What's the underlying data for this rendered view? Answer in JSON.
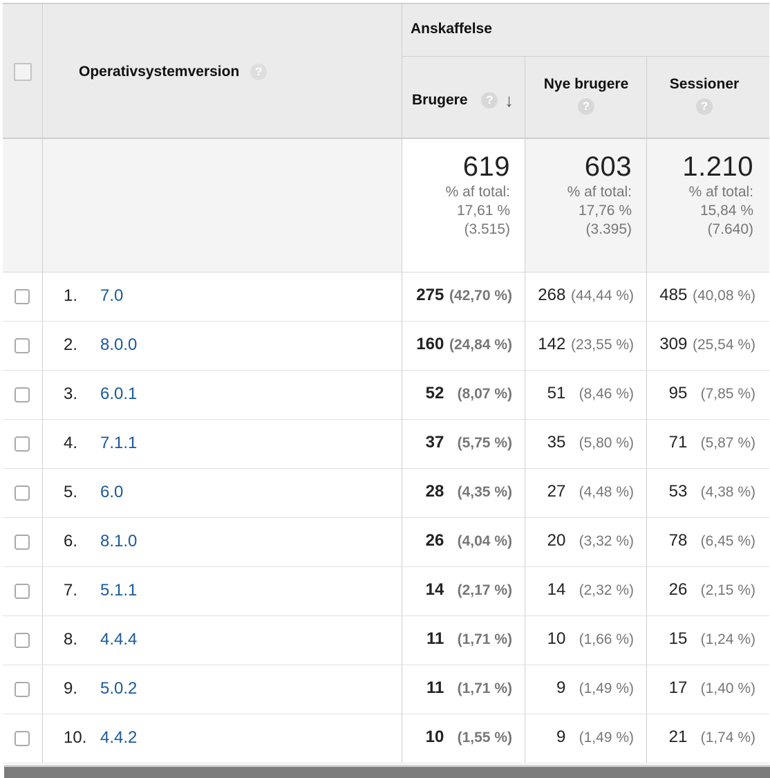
{
  "header": {
    "dimension_label": "Operativsystemversion",
    "group_label": "Anskaffelse",
    "col_users": "Brugere",
    "col_new_users": "Nye brugere",
    "col_sessions": "Sessioner",
    "help_glyph": "?",
    "sort_glyph": "↓"
  },
  "totals": {
    "users": {
      "value": "619",
      "pct_label": "% af total:",
      "pct": "17,61 %",
      "total": "(3.515)"
    },
    "new_users": {
      "value": "603",
      "pct_label": "% af total:",
      "pct": "17,76 %",
      "total": "(3.395)"
    },
    "sessions": {
      "value": "1.210",
      "pct_label": "% af total:",
      "pct": "15,84 %",
      "total": "(7.640)"
    }
  },
  "rows": [
    {
      "rank": "1.",
      "version": "7.0",
      "users": "275",
      "users_pct": "(42,70 %)",
      "new_users": "268",
      "new_users_pct": "(44,44 %)",
      "sessions": "485",
      "sessions_pct": "(40,08 %)"
    },
    {
      "rank": "2.",
      "version": "8.0.0",
      "users": "160",
      "users_pct": "(24,84 %)",
      "new_users": "142",
      "new_users_pct": "(23,55 %)",
      "sessions": "309",
      "sessions_pct": "(25,54 %)"
    },
    {
      "rank": "3.",
      "version": "6.0.1",
      "users": "52",
      "users_pct": "(8,07 %)",
      "new_users": "51",
      "new_users_pct": "(8,46 %)",
      "sessions": "95",
      "sessions_pct": "(7,85 %)"
    },
    {
      "rank": "4.",
      "version": "7.1.1",
      "users": "37",
      "users_pct": "(5,75 %)",
      "new_users": "35",
      "new_users_pct": "(5,80 %)",
      "sessions": "71",
      "sessions_pct": "(5,87 %)"
    },
    {
      "rank": "5.",
      "version": "6.0",
      "users": "28",
      "users_pct": "(4,35 %)",
      "new_users": "27",
      "new_users_pct": "(4,48 %)",
      "sessions": "53",
      "sessions_pct": "(4,38 %)"
    },
    {
      "rank": "6.",
      "version": "8.1.0",
      "users": "26",
      "users_pct": "(4,04 %)",
      "new_users": "20",
      "new_users_pct": "(3,32 %)",
      "sessions": "78",
      "sessions_pct": "(6,45 %)"
    },
    {
      "rank": "7.",
      "version": "5.1.1",
      "users": "14",
      "users_pct": "(2,17 %)",
      "new_users": "14",
      "new_users_pct": "(2,32 %)",
      "sessions": "26",
      "sessions_pct": "(2,15 %)"
    },
    {
      "rank": "8.",
      "version": "4.4.4",
      "users": "11",
      "users_pct": "(1,71 %)",
      "new_users": "10",
      "new_users_pct": "(1,66 %)",
      "sessions": "15",
      "sessions_pct": "(1,24 %)"
    },
    {
      "rank": "9.",
      "version": "5.0.2",
      "users": "11",
      "users_pct": "(1,71 %)",
      "new_users": "9",
      "new_users_pct": "(1,49 %)",
      "sessions": "17",
      "sessions_pct": "(1,40 %)"
    },
    {
      "rank": "10.",
      "version": "4.4.2",
      "users": "10",
      "users_pct": "(1,55 %)",
      "new_users": "9",
      "new_users_pct": "(1,49 %)",
      "sessions": "21",
      "sessions_pct": "(1,74 %)"
    }
  ]
}
